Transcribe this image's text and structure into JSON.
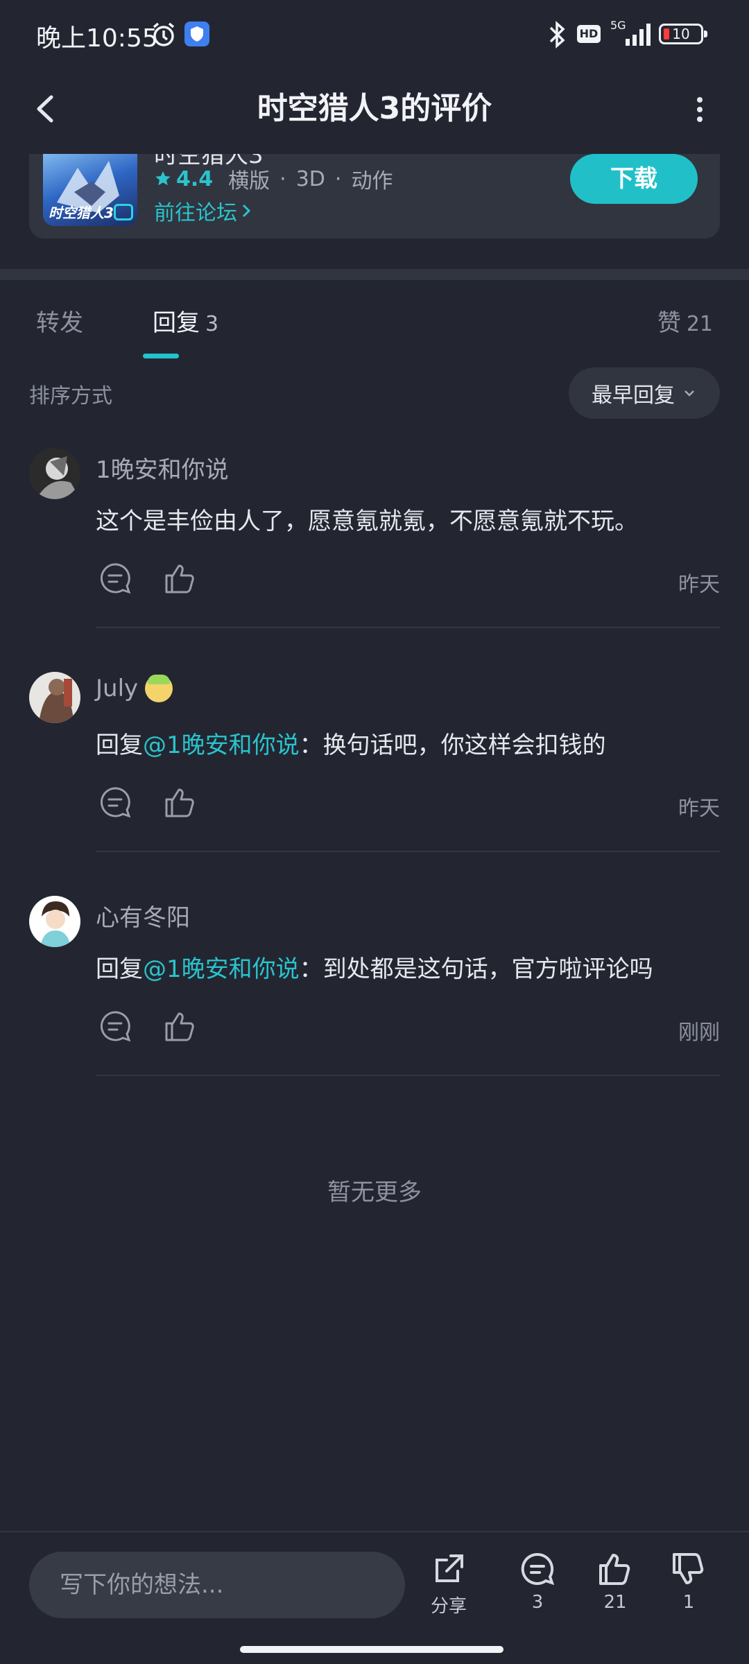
{
  "status_bar": {
    "time": "晚上10:55",
    "network": "5G",
    "hd_label": "HD",
    "battery": "10",
    "icons": [
      "alarm-icon",
      "shield-icon",
      "bluetooth-icon",
      "signal-icon",
      "battery-icon"
    ]
  },
  "header": {
    "title": "时空猎人3的评价",
    "icons": [
      "back-arrow-icon",
      "more-dots-icon"
    ]
  },
  "game": {
    "name_partial": "时空猎人3",
    "icon_text": "时空猎人3",
    "rating": "4.4",
    "tags": [
      "横版",
      "3D",
      "动作"
    ],
    "forum_link": "前往论坛",
    "download_label": "下载"
  },
  "tabs": {
    "forward_label": "转发",
    "reply_label": "回复",
    "reply_count": "3",
    "likes_label": "赞",
    "likes_count": "21"
  },
  "sort": {
    "label": "排序方式",
    "selected": "最早回复"
  },
  "comments": [
    {
      "username": "1晚安和你说",
      "prefix": "",
      "mention": "",
      "text": "这个是丰俭由人了，愿意氪就氪，不愿意氪就不玩。",
      "time": "昨天"
    },
    {
      "username": "July",
      "prefix": "回复",
      "mention": "@1晚安和你说",
      "text": "：换句话吧，你这样会扣钱的",
      "time": "昨天"
    },
    {
      "username": "心有冬阳",
      "prefix": "回复",
      "mention": "@1晚安和你说",
      "text": "：到处都是这句话，官方啦评论吗",
      "time": "刚刚"
    }
  ],
  "no_more": "暂无更多",
  "bottom_bar": {
    "input_placeholder": "写下你的想法...",
    "share_label": "分享",
    "comment_count": "3",
    "like_count": "21",
    "dislike_count": "1"
  },
  "colors": {
    "background": "#232631",
    "card": "#31353f",
    "accent": "#21c0c8",
    "text_primary": "#e6e8ee",
    "text_secondary": "#8e92a0"
  }
}
